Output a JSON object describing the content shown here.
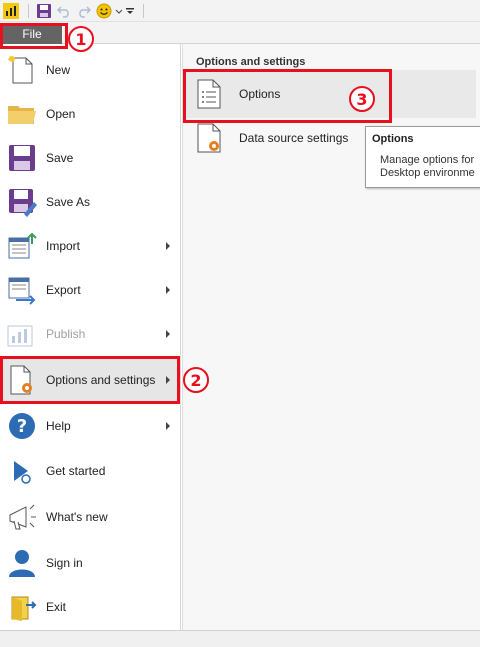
{
  "quick_access": {
    "icons": [
      "power-bi-icon",
      "save-icon",
      "undo-icon",
      "redo-icon",
      "smiley-icon",
      "customize-dropdown-icon"
    ]
  },
  "tabs": {
    "file_label": "File"
  },
  "left_menu": {
    "items": [
      {
        "label": "New",
        "icon": "new-file-icon",
        "has_arrow": false
      },
      {
        "label": "Open",
        "icon": "folder-icon",
        "has_arrow": false
      },
      {
        "label": "Save",
        "icon": "save-icon",
        "has_arrow": false
      },
      {
        "label": "Save As",
        "icon": "save-as-icon",
        "has_arrow": false
      },
      {
        "label": "Import",
        "icon": "import-icon",
        "has_arrow": true
      },
      {
        "label": "Export",
        "icon": "export-icon",
        "has_arrow": true
      },
      {
        "label": "Publish",
        "icon": "publish-icon",
        "has_arrow": true,
        "disabled": true
      },
      {
        "label": "Options and settings",
        "icon": "options-settings-icon",
        "has_arrow": true,
        "selected": true
      },
      {
        "label": "Help",
        "icon": "help-icon",
        "has_arrow": true
      },
      {
        "label": "Get started",
        "icon": "get-started-icon",
        "has_arrow": false
      },
      {
        "label": "What's new",
        "icon": "megaphone-icon",
        "has_arrow": false
      },
      {
        "label": "Sign in",
        "icon": "user-icon",
        "has_arrow": false
      },
      {
        "label": "Exit",
        "icon": "exit-icon",
        "has_arrow": false
      }
    ]
  },
  "right_panel": {
    "heading": "Options and settings",
    "items": [
      {
        "label": "Options",
        "icon": "options-icon"
      },
      {
        "label": "Data source settings",
        "icon": "data-source-settings-icon"
      }
    ]
  },
  "tooltip": {
    "title": "Options",
    "line1": "Manage options for",
    "line2": "Desktop environme"
  },
  "annotations": {
    "step1": "1",
    "step2": "2",
    "step3": "3",
    "color": "#e8101e"
  },
  "colors": {
    "file_tab": "#646464",
    "panel_bg": "#f7f7f7",
    "accent_orange": "#e67e22",
    "save_purple": "#6b3d8c"
  }
}
